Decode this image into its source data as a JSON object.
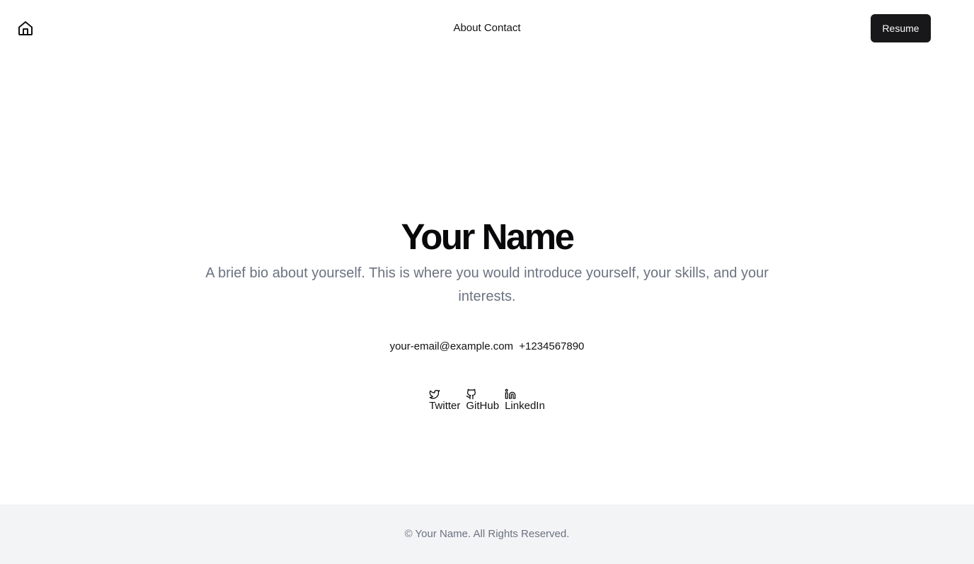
{
  "header": {
    "home_icon": "home-icon",
    "nav_about": "About",
    "nav_contact": "Contact",
    "resume_label": "Resume"
  },
  "hero": {
    "name": "Your Name",
    "bio": "A brief bio about yourself. This is where you would introduce yourself, your skills, and your interests."
  },
  "contact": {
    "email": "your-email@example.com",
    "phone": "+1234567890"
  },
  "socials": [
    {
      "label": "Twitter",
      "icon": "twitter-icon"
    },
    {
      "label": "GitHub",
      "icon": "github-icon"
    },
    {
      "label": "LinkedIn",
      "icon": "linkedin-icon"
    }
  ],
  "footer": {
    "text": "© Your Name. All Rights Reserved."
  },
  "colors": {
    "button_bg": "#18181b",
    "muted_text": "#6b7280",
    "footer_bg": "#f3f4f6"
  }
}
